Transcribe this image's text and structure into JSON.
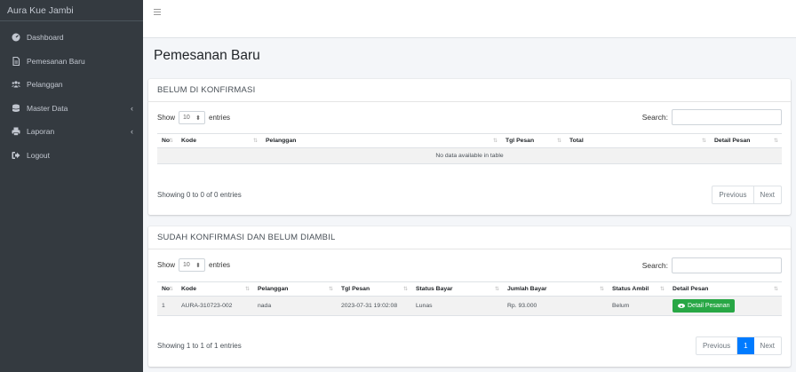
{
  "brand": "Aura Kue Jambi",
  "nav": [
    {
      "label": "Dashboard",
      "icon": "dashboard-icon"
    },
    {
      "label": "Pemesanan Baru",
      "icon": "file-icon"
    },
    {
      "label": "Pelanggan",
      "icon": "users-icon"
    },
    {
      "label": "Master Data",
      "icon": "database-icon",
      "chevron": "‹"
    },
    {
      "label": "Laporan",
      "icon": "printer-icon",
      "chevron": "‹"
    },
    {
      "label": "Logout",
      "icon": "logout-icon"
    }
  ],
  "page_title": "Pemesanan Baru",
  "card1": {
    "title": "BELUM DI KONFIRMASI",
    "show": "Show",
    "entries_value": "10",
    "entries": "entries",
    "search_label": "Search:",
    "columns": [
      "No",
      "Kode",
      "Pelanggan",
      "Tgl Pesan",
      "Total",
      "Detail Pesan"
    ],
    "empty_text": "No data available in table",
    "info": "Showing 0 to 0 of 0 entries",
    "prev": "Previous",
    "next": "Next"
  },
  "card2": {
    "title": "SUDAH KONFIRMASI DAN BELUM DIAMBIL",
    "show": "Show",
    "entries_value": "10",
    "entries": "entries",
    "search_label": "Search:",
    "columns": [
      "No",
      "Kode",
      "Pelanggan",
      "Tgl Pesan",
      "Status Bayar",
      "Jumlah Bayar",
      "Status Ambil",
      "Detail Pesan"
    ],
    "rows": [
      {
        "no": "1",
        "kode": "AURA-310723-002",
        "pelanggan": "nada",
        "tgl": "2023-07-31 19:02:08",
        "status_bayar": "Lunas",
        "jumlah": "Rp. 93.000",
        "status_ambil": "Belum",
        "button": "Detail Pesanan"
      }
    ],
    "info": "Showing 1 to 1 of 1 entries",
    "prev": "Previous",
    "page": "1",
    "next": "Next"
  },
  "colors": {
    "sidebar": "#343a40",
    "primary": "#007bff",
    "success": "#28a745"
  }
}
